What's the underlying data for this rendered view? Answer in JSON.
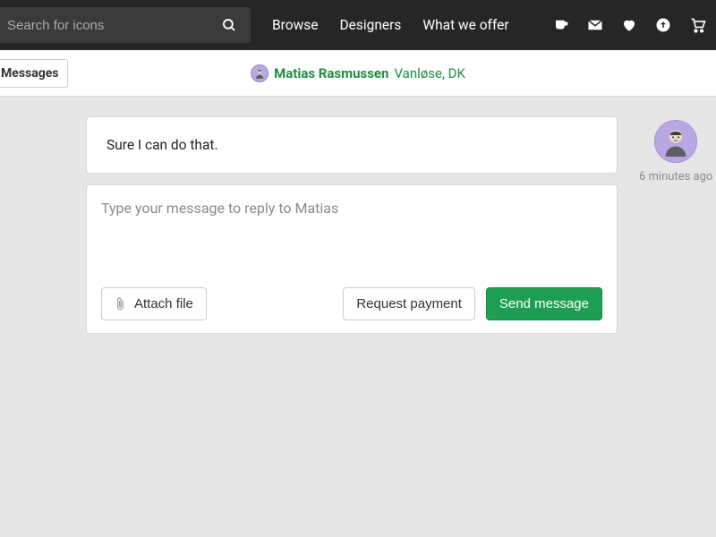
{
  "search": {
    "placeholder": "Search for icons"
  },
  "nav": {
    "browse": "Browse",
    "designers": "Designers",
    "offer": "What we offer"
  },
  "tab": {
    "messages": "Messages"
  },
  "profile": {
    "name": "Matias Rasmussen",
    "location": "Vanløse, DK"
  },
  "message": {
    "text": "Sure I can do that.",
    "timestamp": "6 minutes ago"
  },
  "reply": {
    "placeholder": "Type your message to reply to Matias",
    "attach": "Attach file",
    "request_payment": "Request payment",
    "send": "Send message"
  }
}
